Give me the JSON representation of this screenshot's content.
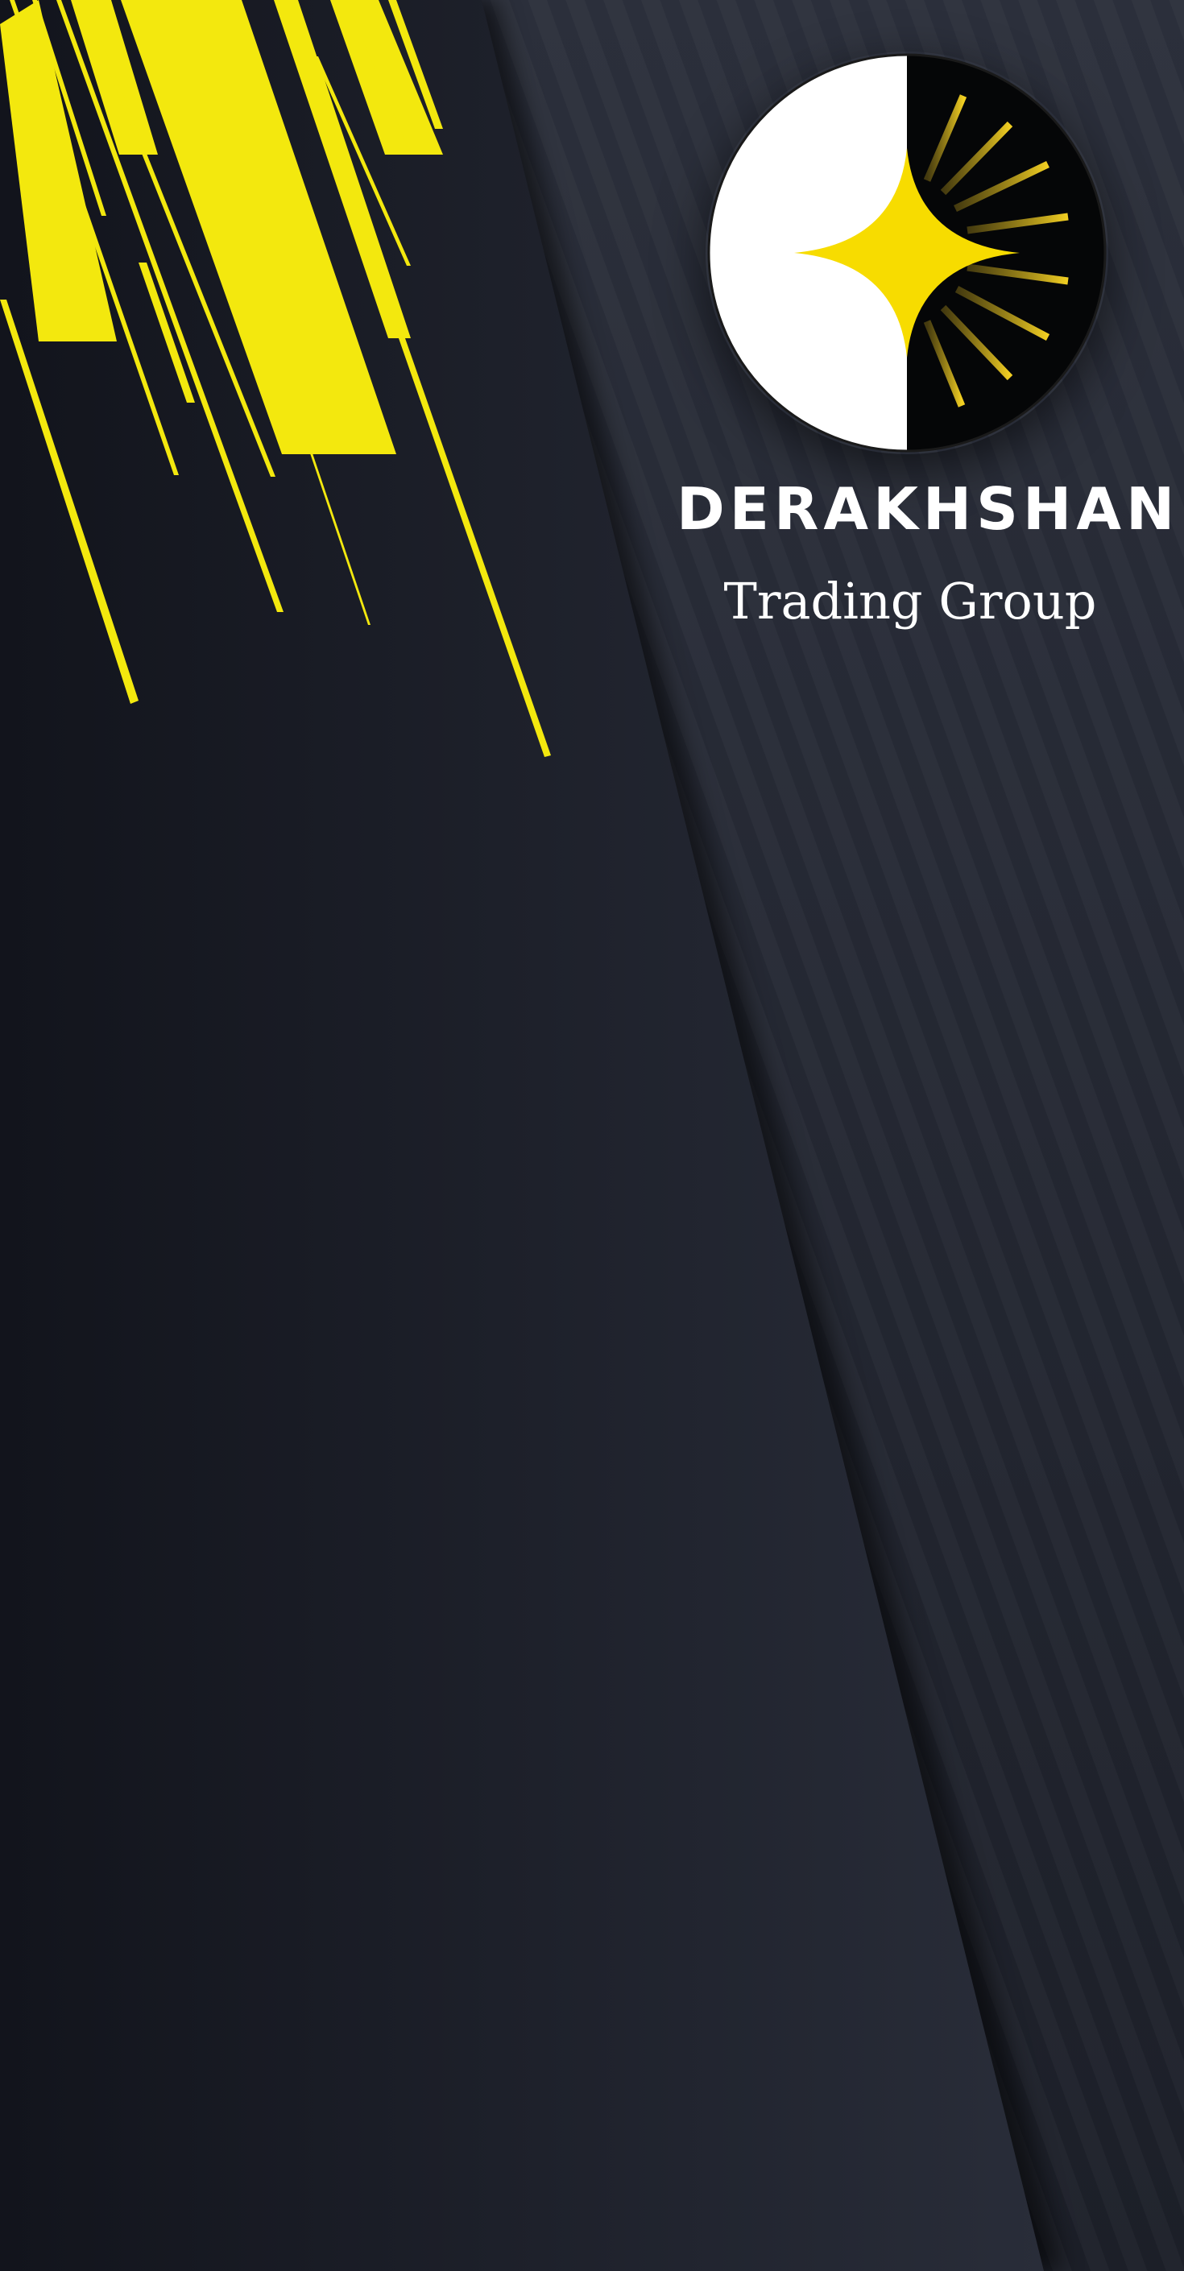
{
  "brand": {
    "name": "DERAKHSHAN",
    "tagline": "Trading Group"
  },
  "logo": {
    "icon": "star-sunburst-icon"
  },
  "colors": {
    "background_dark": "#15171f",
    "background_panel": "#2a2e3a",
    "accent_yellow": "#f3e80e",
    "logo_gold": "#f5d400",
    "text": "#ffffff"
  }
}
